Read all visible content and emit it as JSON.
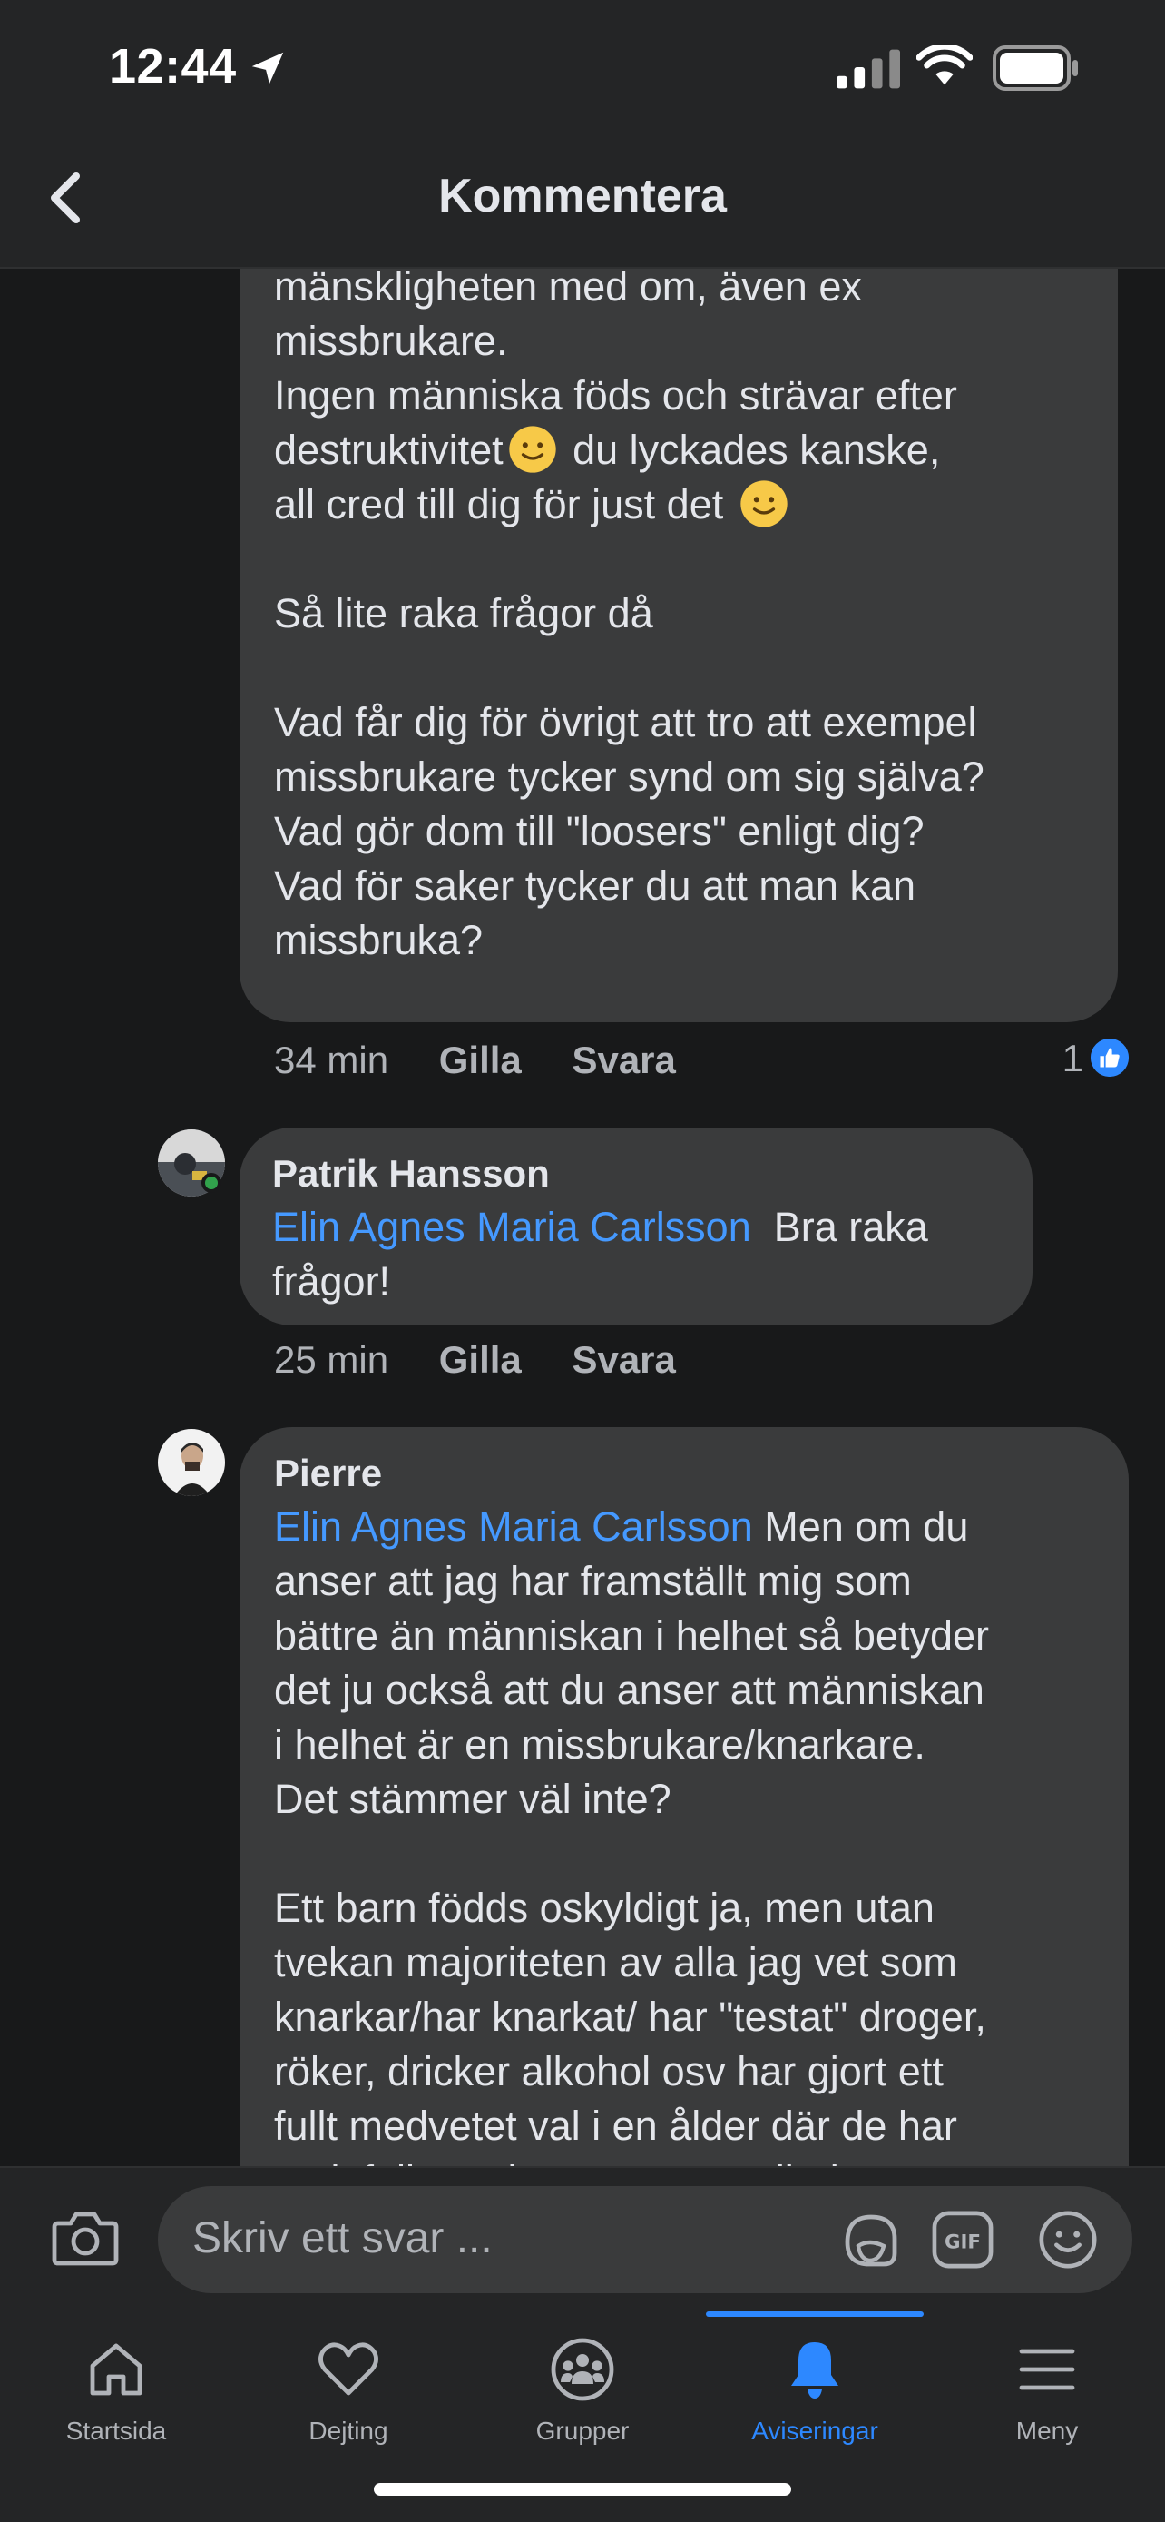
{
  "status_bar": {
    "time": "12:44"
  },
  "header": {
    "title": "Kommentera"
  },
  "comments": [
    {
      "text": "mänskligheten med om, även ex\nmissbrukare.\nIngen människa föds och strävar efter\ndestruktivitet",
      "text_2": " du lyckades kanske,\nall cred till dig för just det ",
      "text_3": "\n\nSå lite raka frågor då\n\nVad får dig för övrigt att tro att exempel\nmissbrukare tycker synd om sig själva?\nVad gör dom till \"loosers\" enligt dig?\nVad för saker tycker du att man kan\nmissbruka?",
      "time": "34 min",
      "like_label": "Gilla",
      "reply_label": "Svara",
      "reaction_count": "1"
    },
    {
      "author": "Patrik Hansson",
      "mention": "Elin Agnes Maria Carlsson",
      "text": "  Bra raka\nfrågor!",
      "time": "25 min",
      "like_label": "Gilla",
      "reply_label": "Svara"
    },
    {
      "author": "Pierre",
      "mention": "Elin Agnes Maria Carlsson",
      "text": " Men om du\nanser att jag har framställt mig som\nbättre än människan i helhet så betyder\ndet ju också att du anser att människan\ni helhet är en missbrukare/knarkare.\nDet stämmer väl inte?\n\nEtt barn födds oskyldigt ja, men utan\ntvekan majoriteten av alla jag vet som\nknarkar/har knarkat/ har \"testat\" droger,\nröker, dricker alkohol osv har gjort ett\nfullt medvetet val i en ålder där de har\nvarit fullt medvetna om att allt det..."
    }
  ],
  "composer": {
    "placeholder": "Skriv ett svar ..."
  },
  "tabs": [
    {
      "label": "Startsida",
      "icon": "home-icon"
    },
    {
      "label": "Dejting",
      "icon": "heart-icon"
    },
    {
      "label": "Grupper",
      "icon": "groups-icon"
    },
    {
      "label": "Aviseringar",
      "icon": "bell-icon",
      "active": true
    },
    {
      "label": "Meny",
      "icon": "menu-icon"
    }
  ],
  "colors": {
    "accent": "#2d88ff",
    "mention": "#4599ff",
    "bubble": "#3a3b3c",
    "background": "#18191a"
  }
}
